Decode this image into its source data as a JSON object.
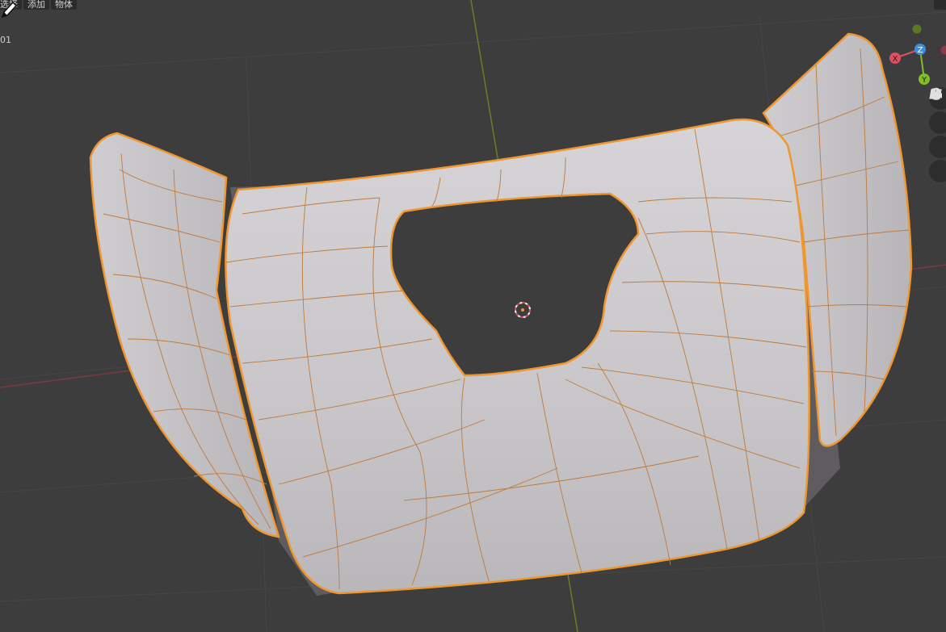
{
  "app": "Blender",
  "viewport": {
    "mode": "3D Viewport",
    "object_state": "selected",
    "frame_label": "01"
  },
  "menu": {
    "items": [
      "选择",
      "添加",
      "物体"
    ]
  },
  "colors": {
    "background": "#3d3d3d",
    "mesh_fill": "#c9c7c9",
    "selection_outline": "#f0962e",
    "x_axis": "#e04f5f",
    "y_axis": "#7fbf2a",
    "z_axis": "#3d8fe0"
  },
  "gizmo": {
    "x_label": "X",
    "y_label": "Y",
    "z_label": "Z"
  },
  "nav_buttons": [
    {
      "icon": "zoom-icon"
    },
    {
      "icon": "hand-pan-icon"
    },
    {
      "icon": "camera-icon"
    },
    {
      "icon": "grid-ortho-icon"
    }
  ]
}
